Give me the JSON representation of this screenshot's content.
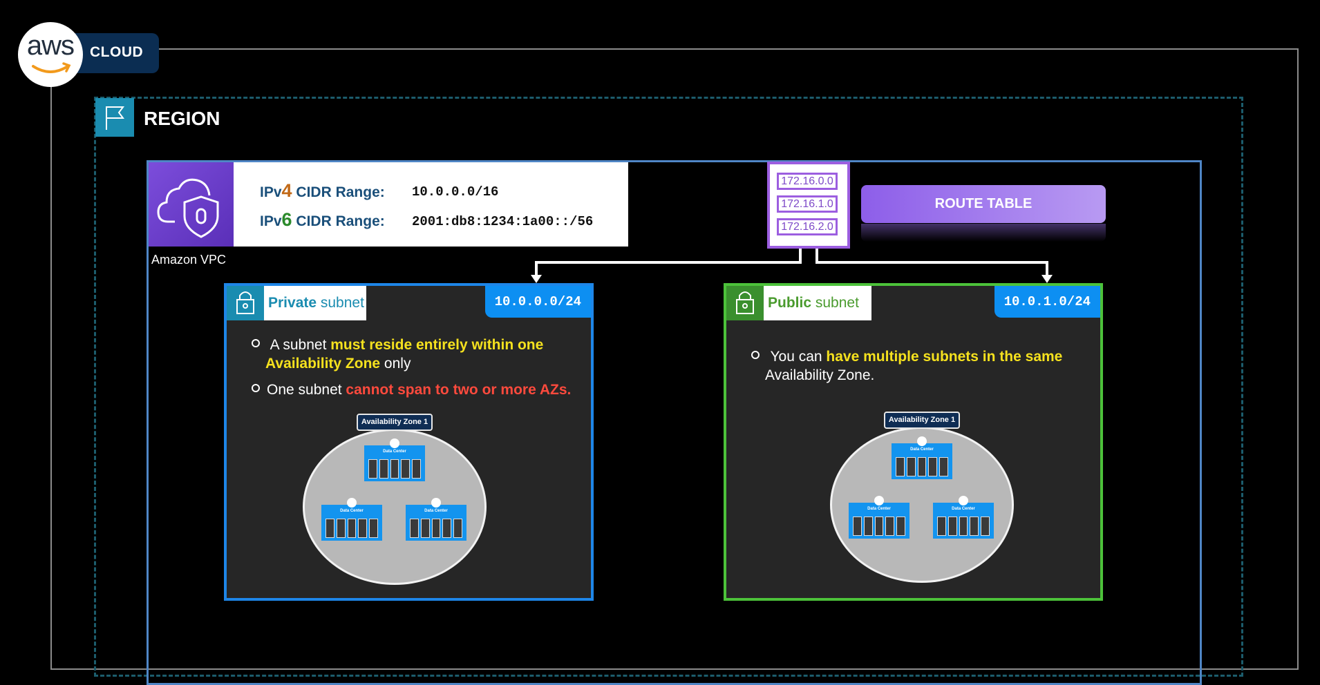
{
  "aws": {
    "logo_text": "aws",
    "cloud_label": "CLOUD"
  },
  "region": {
    "label": "REGION"
  },
  "vpc": {
    "label": "Amazon VPC",
    "ipv4": {
      "prefix": "IPv",
      "version": "4",
      "suffix": " CIDR Range:",
      "value": "10.0.0.0/16"
    },
    "ipv6": {
      "prefix": "IPv",
      "version": "6",
      "suffix": " CIDR Range:",
      "value": "2001:db8:1234:1a00::/56"
    }
  },
  "route_table": {
    "entries": [
      "172.16.0.0",
      "172.16.1.0",
      "172.16.2.0"
    ],
    "button_label": "ROUTE TABLE"
  },
  "private_subnet": {
    "title_bold": "Private",
    "title_rest": " subnet",
    "cidr": "10.0.0.0/24",
    "bullet1_a": " A subnet ",
    "bullet1_b": "must reside entirely within one",
    "bullet1_c": "Availability Zone",
    "bullet1_d": " only",
    "bullet2_a": "One subnet ",
    "bullet2_b": "cannot span to two or more AZs",
    "bullet2_c": ".",
    "az_label": "Availability Zone 1",
    "dc_label": "Data Center"
  },
  "public_subnet": {
    "title_bold": "Public",
    "title_rest": " subnet",
    "cidr": "10.0.1.0/24",
    "bullet1_a": " You can ",
    "bullet1_b": "have multiple subnets in the same",
    "bullet1_c": "Availability Zone.",
    "az_label": "Availability Zone 1",
    "dc_label": "Data Center"
  },
  "colors": {
    "private_accent": "#1e86e8",
    "public_accent": "#4cc23a",
    "route_table_accent": "#9c5ee0",
    "highlight_yellow": "#f5e11e",
    "highlight_red": "#ff4a3d"
  }
}
